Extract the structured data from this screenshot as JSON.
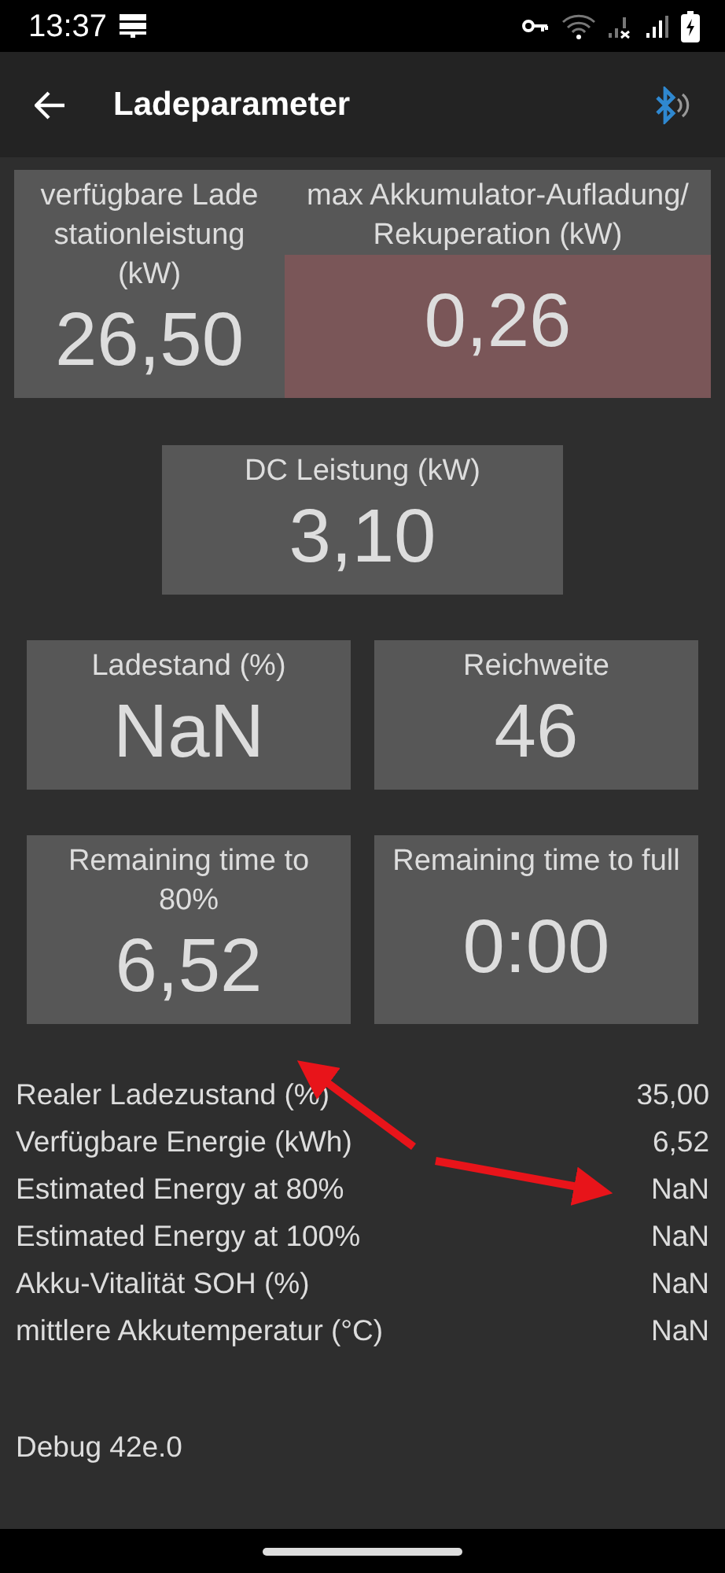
{
  "status_bar": {
    "time": "13:37"
  },
  "header": {
    "title": "Ladeparameter"
  },
  "tile_rows": [
    {
      "joined": true,
      "tiles": [
        {
          "label": "verfügbare Lade stationleistung (kW)",
          "value": "26,50",
          "alert": false
        },
        {
          "label": "max Akkumulator-Aufladung/ Rekuperation (kW)",
          "value": "0,26",
          "alert": true
        }
      ]
    },
    {
      "joined": false,
      "tiles": [
        {
          "label": "DC Leistung (kW)",
          "value": "3,10",
          "alert": false
        }
      ]
    },
    {
      "joined": false,
      "tiles": [
        {
          "label": "Ladestand (%)",
          "value": "NaN",
          "alert": false
        },
        {
          "label": "Reichweite",
          "value": "46",
          "alert": false
        }
      ]
    },
    {
      "joined": false,
      "tiles": [
        {
          "label": "Remaining time to 80%",
          "value": "6,52",
          "alert": false
        },
        {
          "label": "Remaining time to full",
          "value": "0:00",
          "alert": false
        }
      ]
    }
  ],
  "readings": [
    {
      "label": "Realer Ladezustand (%)",
      "value": "35,00"
    },
    {
      "label": "Verfügbare Energie (kWh)",
      "value": "6,52"
    },
    {
      "label": "Estimated Energy at 80%",
      "value": "NaN"
    },
    {
      "label": "Estimated Energy at 100%",
      "value": "NaN"
    },
    {
      "label": "Akku-Vitalität SOH (%)",
      "value": "NaN"
    },
    {
      "label": "mittlere Akkutemperatur (°C)",
      "value": "NaN"
    }
  ],
  "debug": "Debug 42e.0"
}
